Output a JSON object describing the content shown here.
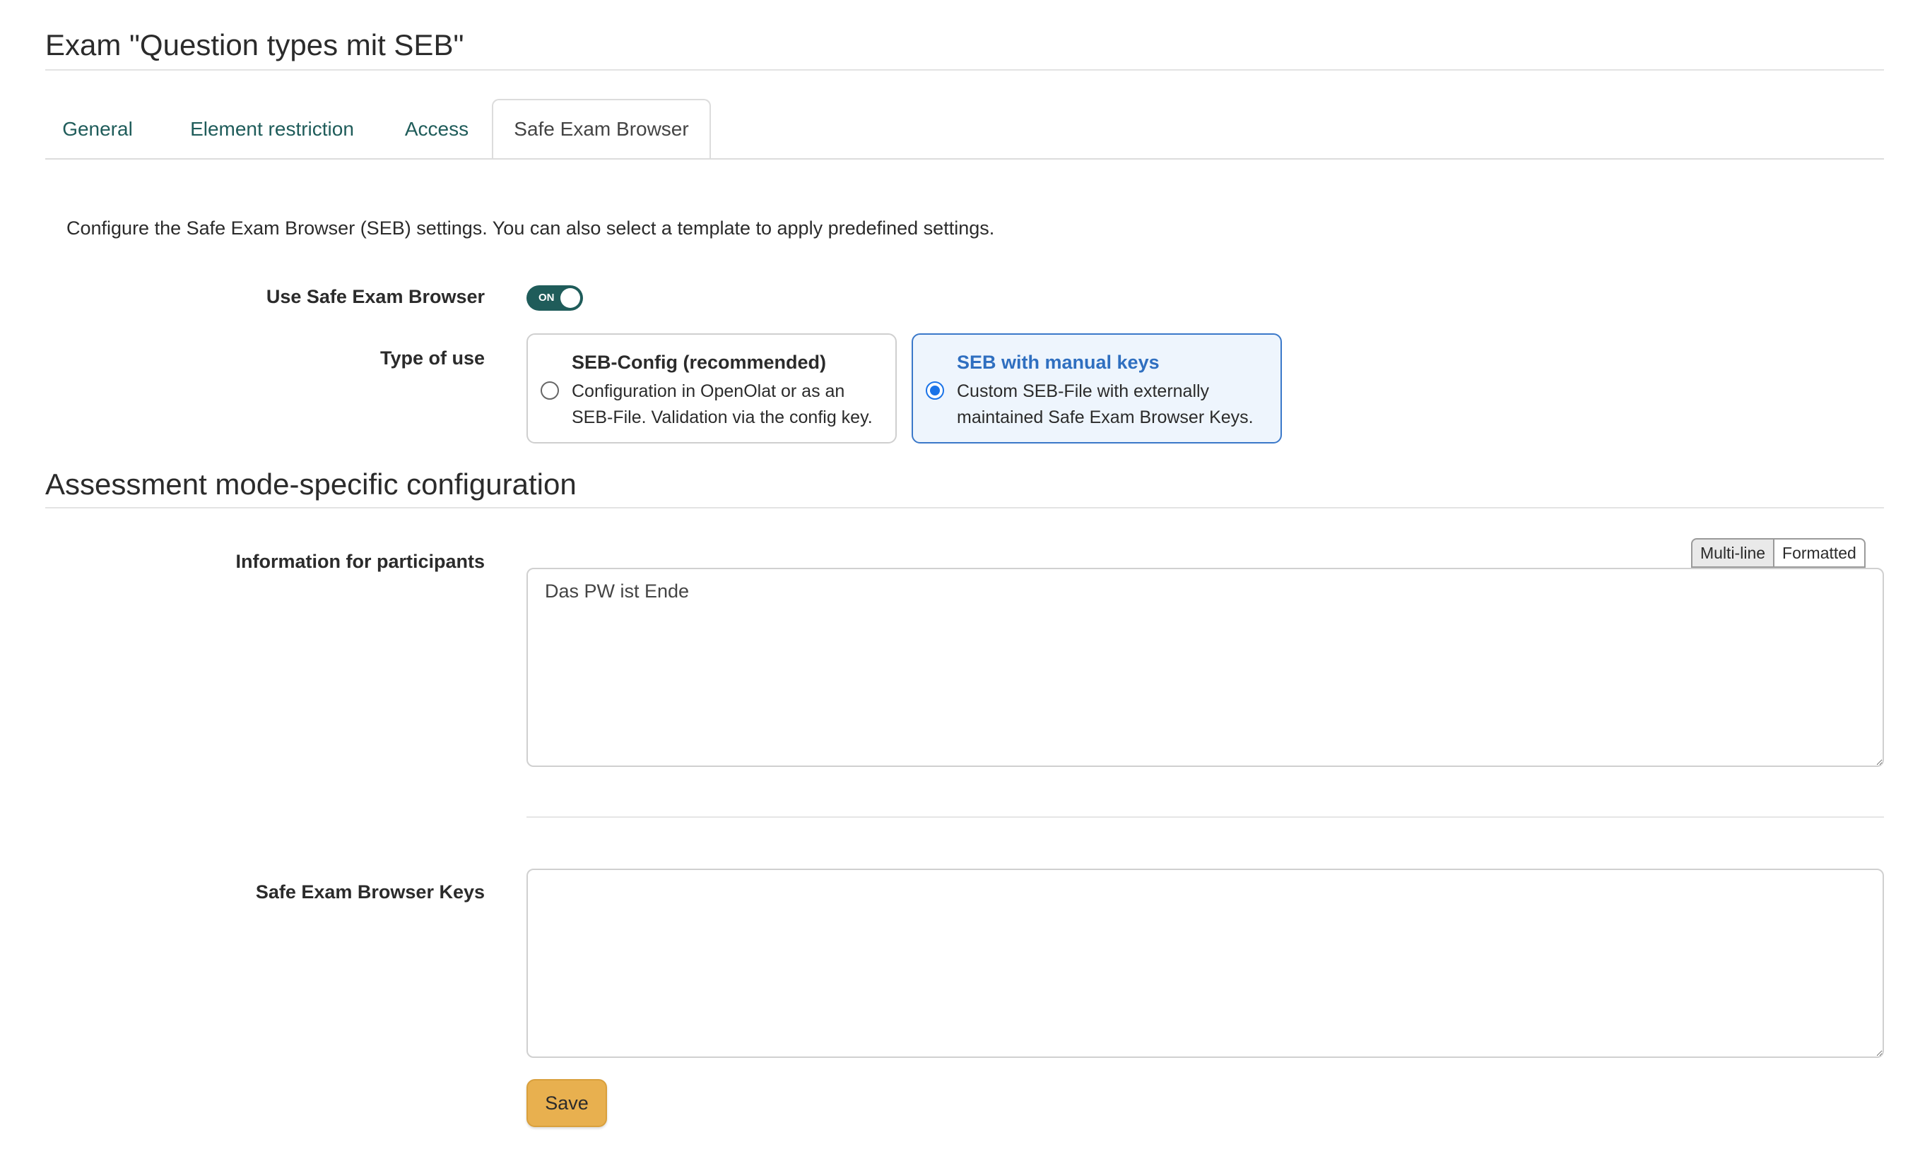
{
  "page": {
    "title": "Exam \"Question types mit SEB\""
  },
  "tabs": [
    {
      "label": "General"
    },
    {
      "label": "Element restriction"
    },
    {
      "label": "Access"
    },
    {
      "label": "Safe Exam Browser",
      "active": true
    }
  ],
  "description": "Configure the Safe Exam Browser (SEB) settings. You can also select a template to apply predefined settings.",
  "use_seb": {
    "label": "Use Safe Exam Browser",
    "toggle_text": "ON",
    "enabled": true
  },
  "type_of_use": {
    "label": "Type of use",
    "options": [
      {
        "title": "SEB-Config (recommended)",
        "description": "Configuration in OpenOlat or as an SEB-File. Validation via the config key.",
        "selected": false
      },
      {
        "title": "SEB with manual keys",
        "description": "Custom SEB-File with externally maintained Safe Exam Browser Keys.",
        "selected": true
      }
    ]
  },
  "assessment_section": {
    "title": "Assessment mode-specific configuration",
    "info_label": "Information for participants",
    "mode_buttons": [
      "Multi-line",
      "Formatted"
    ],
    "info_value": "Das PW ist Ende",
    "keys_label": "Safe Exam Browser Keys",
    "keys_value": ""
  },
  "save_label": "Save",
  "colors": {
    "accent": "#1f5c5a",
    "selected_border": "#3a78c9",
    "save_button": "#e8b04f"
  }
}
